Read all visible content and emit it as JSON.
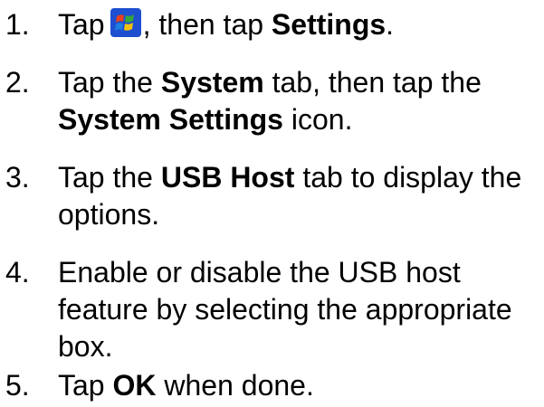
{
  "steps": [
    {
      "number": "1.",
      "parts": {
        "a": "Tap",
        "b": ", then tap",
        "c": "Settings",
        "d": "."
      }
    },
    {
      "number": "2.",
      "parts": {
        "a": "Tap the",
        "b": "System",
        "c": "tab, then tap the",
        "d": "System Settings",
        "e": "icon."
      }
    },
    {
      "number": "3.",
      "parts": {
        "a": "Tap the",
        "b": "USB Host",
        "c": "tab to display the",
        "d": "options."
      }
    },
    {
      "number": "4.",
      "parts": {
        "a": "Enable or disable the USB host",
        "b": "feature by selecting the appropriate",
        "c": "box."
      }
    },
    {
      "number": "5.",
      "parts": {
        "a": "Tap",
        "b": "OK",
        "c": "when done."
      }
    }
  ],
  "icons": {
    "start": "windows-start-icon"
  },
  "colors": {
    "text": "#000000",
    "icon_blue": "#1e4fd0",
    "icon_red": "#e8401c",
    "icon_green": "#34a83a",
    "icon_yellow": "#f5c10d"
  }
}
